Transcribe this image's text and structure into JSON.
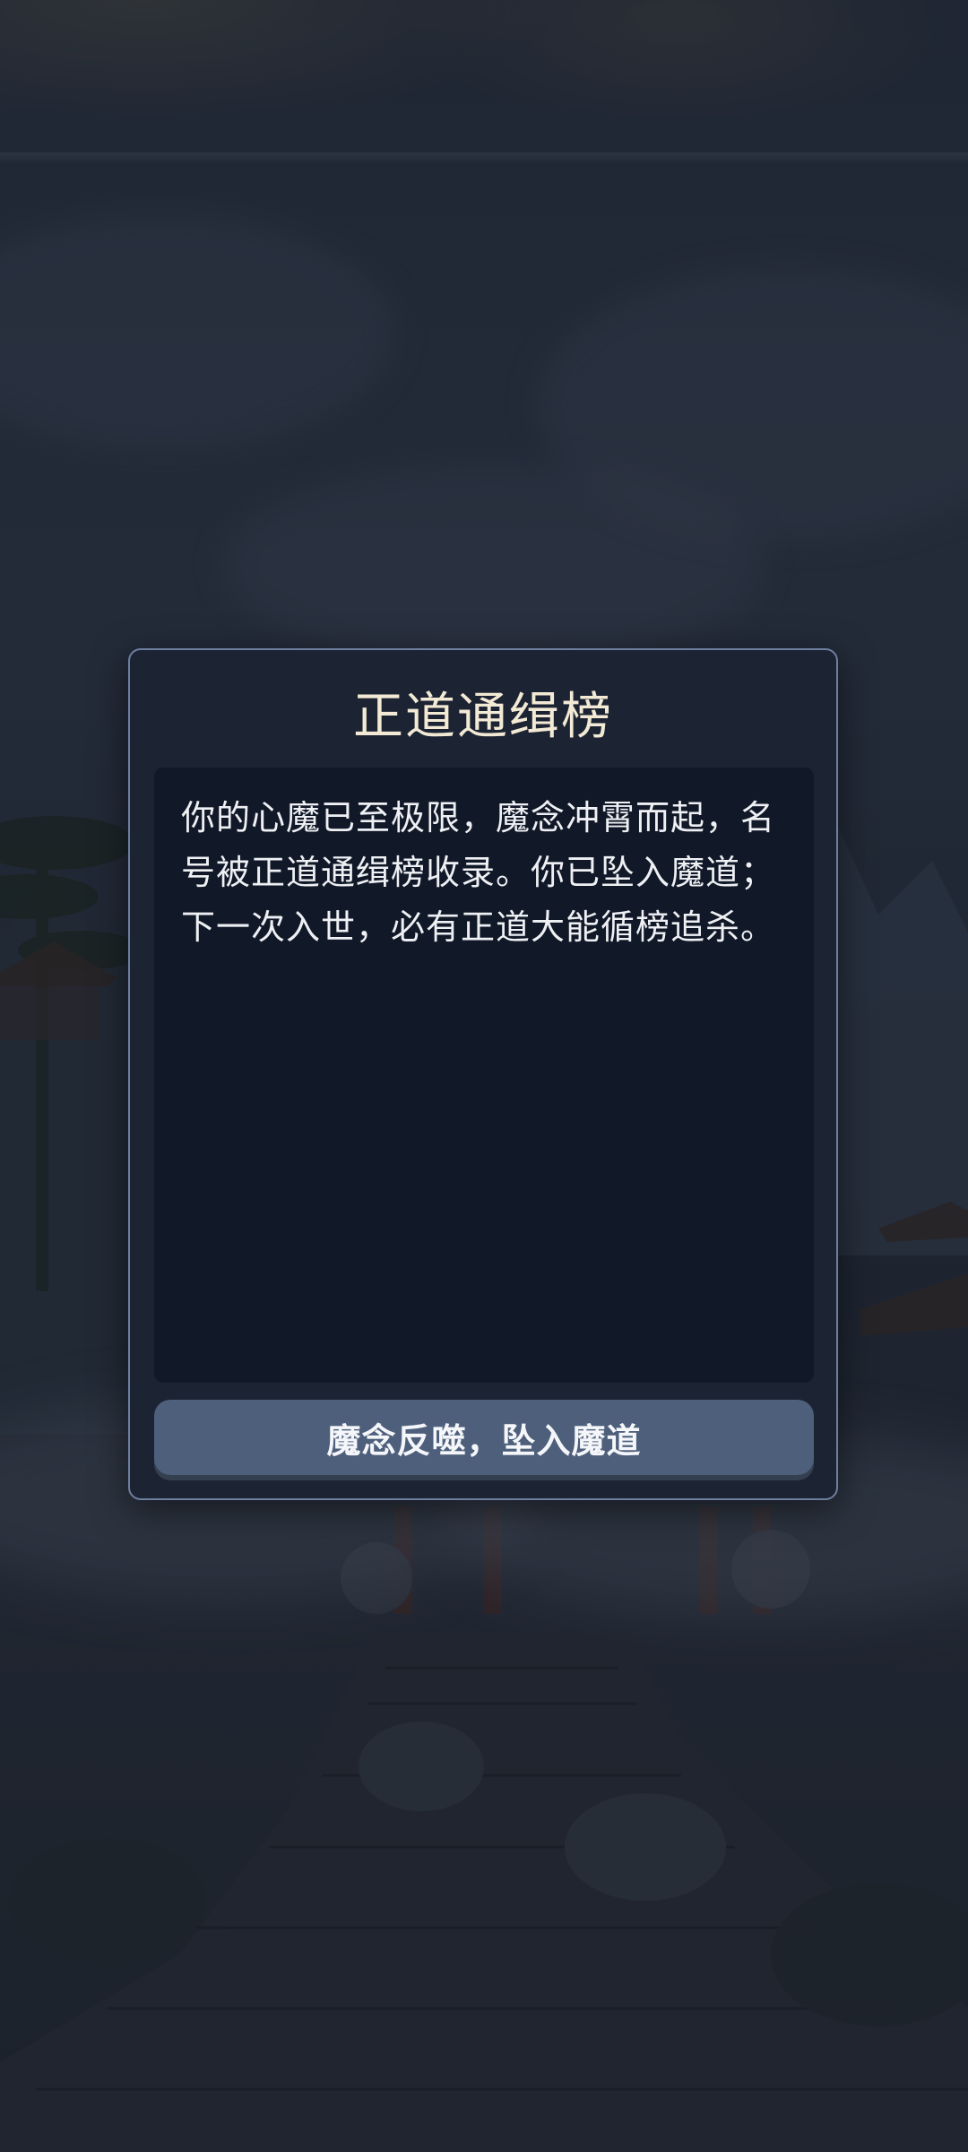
{
  "dialog": {
    "title": "正道通缉榜",
    "body": "你的心魔已至极限，魔念冲霄而起，名号被正道通缉榜收录。你已坠入魔道；下一次入世，必有正道大能循榜追杀。",
    "button_label": "魔念反噬，坠入魔道"
  },
  "colors": {
    "dialog_bg": "#1c2333",
    "dialog_border": "#6d7f9f",
    "body_bg": "#111827",
    "title_text": "#f3ead5",
    "button_bg": "#4e5f7b"
  }
}
